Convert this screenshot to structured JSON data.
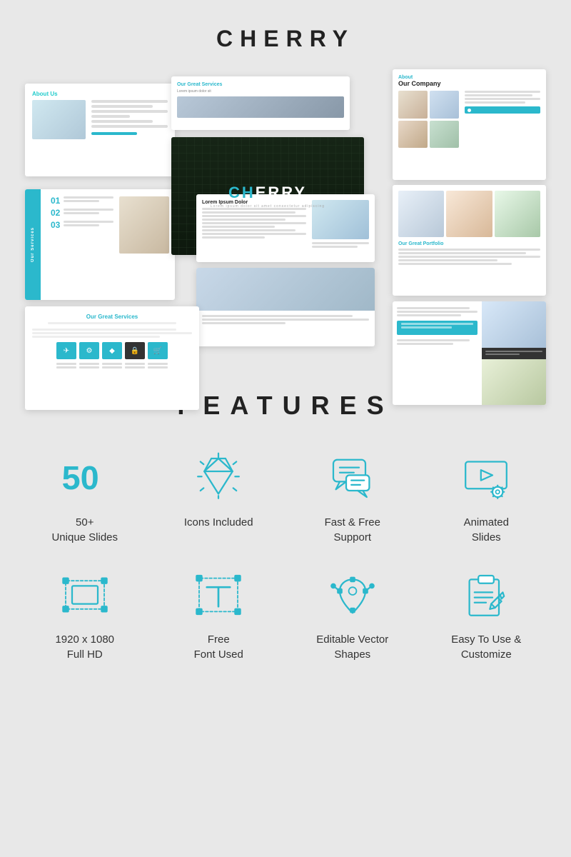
{
  "title": "CHERRY",
  "features_title": "FEATURES",
  "features": [
    {
      "id": "unique-slides",
      "big_num": "50",
      "label": "50+\nUnique Slides",
      "icon": "number-50"
    },
    {
      "id": "icons-included",
      "label": "Icons Included",
      "icon": "diamond"
    },
    {
      "id": "fast-free-support",
      "label": "Fast & Free\nSupport",
      "icon": "chat"
    },
    {
      "id": "animated-slides",
      "label": "Animated\nSlides",
      "icon": "animated"
    },
    {
      "id": "full-hd",
      "label": "1920 x 1080\nFull HD",
      "icon": "fullhd"
    },
    {
      "id": "free-font",
      "label": "Free\nFont Used",
      "icon": "font"
    },
    {
      "id": "editable-vector",
      "label": "Editable Vector\nShapes",
      "icon": "vector"
    },
    {
      "id": "easy-customize",
      "label": "Easy To Use &\nCustomize",
      "icon": "customize"
    }
  ],
  "colors": {
    "accent": "#2bb8cc",
    "dark": "#222222",
    "bg": "#e8e8e8"
  }
}
